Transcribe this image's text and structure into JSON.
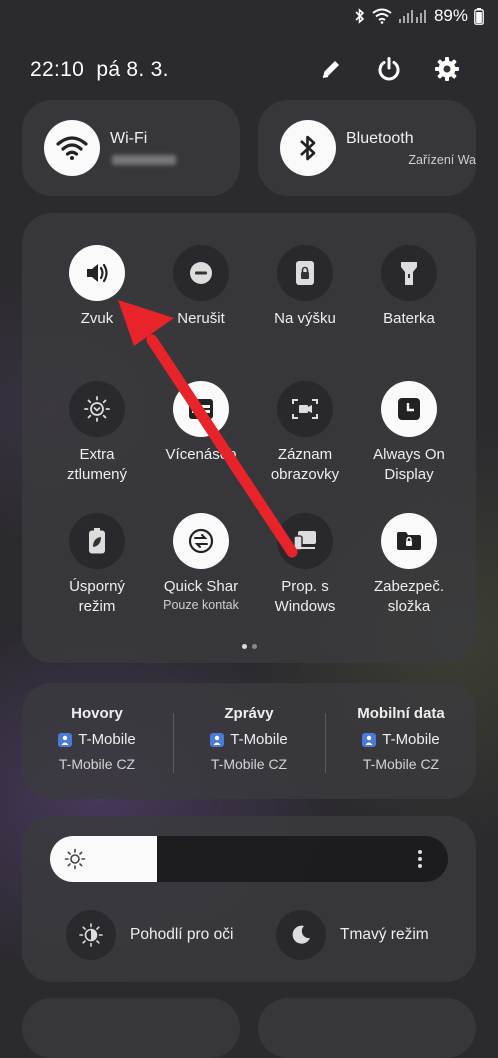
{
  "status_bar": {
    "battery": "89%"
  },
  "header": {
    "time": "22:10",
    "date": "pá 8. 3."
  },
  "connectivity": {
    "wifi": {
      "label": "Wi-Fi"
    },
    "bluetooth": {
      "label": "Bluetooth",
      "sub": "Zařízení Wa"
    }
  },
  "quick_settings": [
    {
      "id": "zvuk",
      "label": "Zvuk",
      "label2": "",
      "sub": "",
      "icon": "speaker-icon",
      "on": true
    },
    {
      "id": "nerusit",
      "label": "Nerušit",
      "label2": "",
      "sub": "",
      "icon": "do-not-disturb-icon",
      "on": false
    },
    {
      "id": "na-vysku",
      "label": "Na výšku",
      "label2": "",
      "sub": "",
      "icon": "portrait-lock-icon",
      "on": false
    },
    {
      "id": "baterka",
      "label": "Baterka",
      "label2": "",
      "sub": "",
      "icon": "flashlight-icon",
      "on": false
    },
    {
      "id": "extra-ztlumeny",
      "label": "Extra",
      "label2": "ztlumený",
      "sub": "",
      "icon": "extra-dim-icon",
      "on": false
    },
    {
      "id": "vicenasobne",
      "label": "Vícenásob",
      "label2": "",
      "sub": "",
      "icon": "multi-window-icon",
      "on": true
    },
    {
      "id": "zaznam",
      "label": "Záznam",
      "label2": "obrazovky",
      "sub": "",
      "icon": "screen-record-icon",
      "on": false
    },
    {
      "id": "always-on",
      "label": "Always On",
      "label2": "Display",
      "sub": "",
      "icon": "clock-icon",
      "on": true
    },
    {
      "id": "usporny",
      "label": "Úsporný",
      "label2": "režim",
      "sub": "",
      "icon": "battery-saver-icon",
      "on": false
    },
    {
      "id": "quick-share",
      "label": "Quick Shar",
      "label2": "",
      "sub": "Pouze kontak",
      "icon": "quick-share-icon",
      "on": true
    },
    {
      "id": "prop-windows",
      "label": "Prop. s",
      "label2": "Windows",
      "sub": "",
      "icon": "link-windows-icon",
      "on": false
    },
    {
      "id": "zabezpec",
      "label": "Zabezpeč.",
      "label2": "složka",
      "sub": "",
      "icon": "secure-folder-icon",
      "on": true
    }
  ],
  "sim": [
    {
      "heading": "Hovory",
      "operator": "T-Mobile",
      "network": "T-Mobile CZ"
    },
    {
      "heading": "Zprávy",
      "operator": "T-Mobile",
      "network": "T-Mobile CZ"
    },
    {
      "heading": "Mobilní data",
      "operator": "T-Mobile",
      "network": "T-Mobile CZ"
    }
  ],
  "brightness": {
    "level": 0.27
  },
  "toggles": {
    "eye_comfort": "Pohodlí pro oči",
    "dark_mode": "Tmavý režim"
  },
  "colors": {
    "annotation": "#e8232a",
    "sim_badge": "#4a7bd8"
  }
}
